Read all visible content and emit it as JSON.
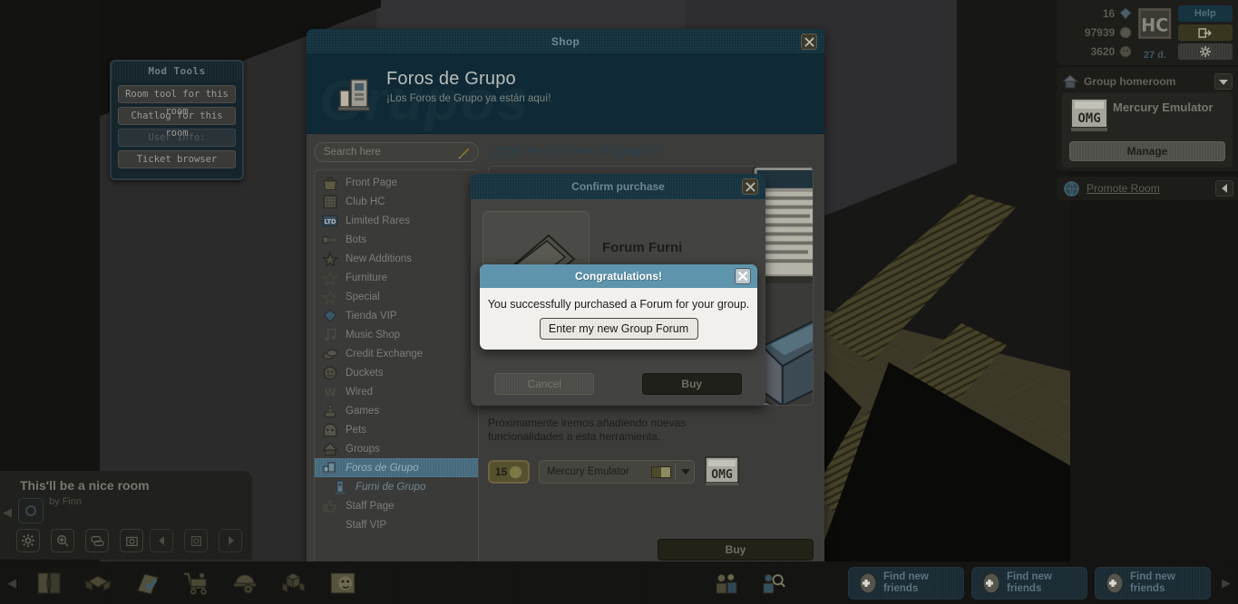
{
  "room": {
    "title": "This'll be a nice room",
    "owner": "by Finn",
    "collapse_icon": "chevron-left-icon",
    "tools": [
      {
        "name": "room-settings-icon",
        "glyph": "⚙"
      },
      {
        "name": "room-zoom-icon",
        "glyph": "⊕"
      },
      {
        "name": "room-chat-icon",
        "glyph": "☰"
      },
      {
        "name": "room-camera-icon",
        "glyph": "▣"
      }
    ],
    "nav": [
      {
        "name": "room-prev-icon",
        "glyph": "◀"
      },
      {
        "name": "room-home-icon",
        "glyph": "◎"
      },
      {
        "name": "room-next-icon",
        "glyph": "▶"
      }
    ]
  },
  "mod_tools": {
    "title": "Mod Tools",
    "buttons": [
      {
        "label": "Room tool for this room",
        "disabled": false
      },
      {
        "label": "Chatlog for this room",
        "disabled": false
      },
      {
        "label": "User info:",
        "disabled": true
      },
      {
        "label": "Ticket browser",
        "disabled": false
      }
    ]
  },
  "shop": {
    "window_title": "Shop",
    "close_icon": "close-icon",
    "banner": {
      "ghost_text": "Grupos",
      "icon": "forum-furni-icon",
      "heading": "Foros de Grupo",
      "subheading": "¡Los Foros de Grupo ya están aquí!"
    },
    "search": {
      "placeholder": "Search here",
      "value": "",
      "icon": "pencil-icon"
    },
    "categories": [
      {
        "label": "Front Page",
        "icon": "bag-icon",
        "state": "normal"
      },
      {
        "label": "Club HC",
        "icon": "hc-icon",
        "state": "normal"
      },
      {
        "label": "Limited Rares",
        "icon": "ltd-icon",
        "state": "normal"
      },
      {
        "label": "Bots",
        "icon": "bot-icon",
        "state": "normal"
      },
      {
        "label": "New Additions",
        "icon": "star-filled-icon",
        "state": "normal"
      },
      {
        "label": "Furniture",
        "icon": "star-outline-icon",
        "state": "normal"
      },
      {
        "label": "Special",
        "icon": "star-outline-icon",
        "state": "normal"
      },
      {
        "label": "Tienda VIP",
        "icon": "gem-icon",
        "state": "normal"
      },
      {
        "label": "Music Shop",
        "icon": "music-note-icon",
        "state": "normal"
      },
      {
        "label": "Credit Exchange",
        "icon": "coins-icon",
        "state": "normal"
      },
      {
        "label": "Duckets",
        "icon": "ducket-icon",
        "state": "normal"
      },
      {
        "label": "Wired",
        "icon": "wired-icon",
        "state": "normal"
      },
      {
        "label": "Games",
        "icon": "joystick-icon",
        "state": "normal"
      },
      {
        "label": "Pets",
        "icon": "pet-icon",
        "state": "normal"
      },
      {
        "label": "Groups",
        "icon": "group-icon",
        "state": "normal"
      },
      {
        "label": "Foros de Grupo",
        "icon": "forum-icon",
        "state": "active"
      },
      {
        "label": "Furni de Grupo",
        "icon": "furni-icon",
        "state": "subactive"
      },
      {
        "label": "Staff Page",
        "icon": "thumbsup-icon",
        "state": "normal"
      },
      {
        "label": "Staff VIP",
        "icon": "none",
        "state": "normal"
      }
    ],
    "content": {
      "question": "¿Qué es un foro de grupo?",
      "promo_line1": "Próximamente iremos añadiendo nuevas",
      "promo_line2": "funcionalidades a esta herramienta.",
      "price": "15",
      "price_icon": "ducket-coin-icon",
      "group_select_value": "Mercury Emulator",
      "group_badge_icon": "omg-badge-icon",
      "buy_label": "Buy"
    }
  },
  "confirm_dialog": {
    "title": "Confirm purchase",
    "close_icon": "close-icon",
    "item_name": "Forum Furni",
    "item_icon": "forum-furni-thumb-icon",
    "cancel_label": "Cancel",
    "buy_label": "Buy"
  },
  "congrats_dialog": {
    "title": "Congratulations!",
    "close_icon": "close-icon",
    "message": "You successfully purchased a Forum for your group.",
    "button_label": "Enter my new Group Forum",
    "header_color": "#5e95ad",
    "body_color": "#f1f0ec"
  },
  "hud": {
    "diamonds": "16",
    "diamond_icon": "diamond-icon",
    "credits": "97939",
    "credit_icon": "credit-coin-icon",
    "duckets": "3620",
    "ducket_icon": "ducket-icon",
    "hc_badge_icon": "hc-badge-icon",
    "hc_days": "27 d.",
    "help_label": "Help",
    "exit_icon": "exit-icon",
    "settings_icon": "gear-icon"
  },
  "group_panel": {
    "header_icon": "group-home-icon",
    "header_title": "Group homeroom",
    "caret_icon": "chevron-down-icon",
    "group_badge_icon": "omg-badge-icon",
    "group_name": "Mercury Emulator",
    "manage_label": "Manage",
    "promote_icon": "globe-icon",
    "promote_label": "Promote Room",
    "promote_arrow_icon": "chevron-left-icon"
  },
  "toolbar": {
    "left_arrow_icon": "chevron-left-icon",
    "right_arrow_icon": "chevron-right-icon",
    "icons": [
      {
        "name": "navigator-icon"
      },
      {
        "name": "inventory-icon"
      },
      {
        "name": "catalogue-icon"
      },
      {
        "name": "shop-cart-icon"
      },
      {
        "name": "helmet-tools-icon"
      },
      {
        "name": "room-builder-icon"
      },
      {
        "name": "avatar-face-icon"
      }
    ],
    "mid_icons": [
      {
        "name": "friends-group-icon"
      },
      {
        "name": "friend-search-icon"
      }
    ],
    "friend_buttons": [
      {
        "line1": "Find new",
        "line2": "friends"
      },
      {
        "line1": "Find new",
        "line2": "friends"
      },
      {
        "line1": "Find new",
        "line2": "friends"
      }
    ]
  }
}
